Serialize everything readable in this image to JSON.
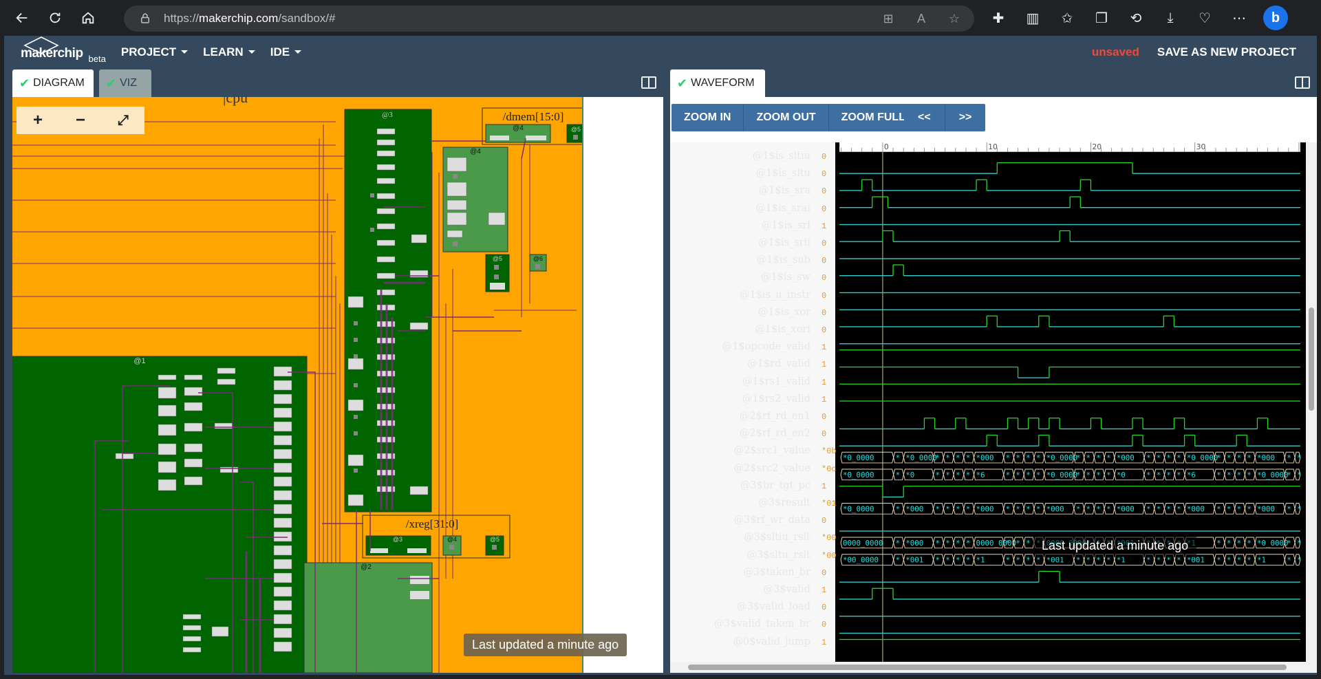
{
  "browser": {
    "url_prefix": "https://",
    "url_host": "makerchip.com",
    "url_path": "/sandbox/#"
  },
  "header": {
    "logo": "makerchip",
    "beta": "beta",
    "menus": [
      "PROJECT",
      "LEARN",
      "IDE"
    ],
    "unsaved": "unsaved",
    "save_new": "SAVE AS NEW PROJECT"
  },
  "left_pane": {
    "tabs": [
      {
        "label": "DIAGRAM",
        "active": true,
        "checked": true
      },
      {
        "label": "VIZ",
        "active": false,
        "checked": true
      }
    ],
    "diagram": {
      "cpu_label": "|cpu",
      "labels": [
        "@3",
        "/dmem[15:0]",
        "@4",
        "@5",
        "@4",
        "@5",
        "@6",
        "@1",
        "/xreg[31:0]",
        "@3",
        "@4",
        "@5",
        "@2"
      ]
    },
    "zoom_in": "+",
    "zoom_out": "−",
    "zoom_fit": "⤢",
    "toast": "Last updated a minute ago"
  },
  "right_pane": {
    "tabs": [
      {
        "label": "WAVEFORM",
        "active": true,
        "checked": true
      }
    ],
    "buttons": [
      "ZOOM IN",
      "ZOOM OUT",
      "ZOOM FULL",
      "<<",
      ">>"
    ],
    "ruler": [
      "0",
      "10",
      "20",
      "30"
    ],
    "toast": "Last updated a minute ago",
    "signals": [
      {
        "name": "@1$is_sltiu",
        "value": "0"
      },
      {
        "name": "@1$is_sltu",
        "value": "0"
      },
      {
        "name": "@1$is_sra",
        "value": "0"
      },
      {
        "name": "@1$is_srai",
        "value": "0"
      },
      {
        "name": "@1$is_srl",
        "value": "1"
      },
      {
        "name": "@1$is_srli",
        "value": "0"
      },
      {
        "name": "@1$is_sub",
        "value": "0"
      },
      {
        "name": "@1$is_sw",
        "value": "0"
      },
      {
        "name": "@1$is_u_instr",
        "value": "0"
      },
      {
        "name": "@1$is_xor",
        "value": "0"
      },
      {
        "name": "@1$is_xori",
        "value": "0"
      },
      {
        "name": "@1$opcode_valid",
        "value": "1"
      },
      {
        "name": "@1$rd_valid",
        "value": "1"
      },
      {
        "name": "@1$rs1_valid",
        "value": "1"
      },
      {
        "name": "@1$rs2_valid",
        "value": "1"
      },
      {
        "name": "@2$rf_rd_en1",
        "value": "0"
      },
      {
        "name": "@2$rf_rd_en2",
        "value": "0"
      },
      {
        "name": "@2$src1_value",
        "value": "*0b"
      },
      {
        "name": "@2$src2_value",
        "value": "*0c"
      },
      {
        "name": "@3$br_tgt_pc",
        "value": "1"
      },
      {
        "name": "@3$result",
        "value": "*01"
      },
      {
        "name": "@3$rf_wr_data",
        "value": "0"
      },
      {
        "name": "@3$sltiu_rslt",
        "value": "*00"
      },
      {
        "name": "@3$sltu_rslt",
        "value": "*00"
      },
      {
        "name": "@3$taken_br",
        "value": "0"
      },
      {
        "name": "@3$valid",
        "value": "1"
      },
      {
        "name": "@3$valid_load",
        "value": "0"
      },
      {
        "name": "@3$valid_taken_br",
        "value": "0"
      },
      {
        "name": "@0$valid_jump",
        "value": "1"
      }
    ],
    "bus_labels": {
      "src1": [
        "*0_0000",
        "*000"
      ],
      "src2": [
        "*0_0000",
        "*6",
        "*0"
      ],
      "result": [
        "*0_0000",
        "*00_0000",
        "*000",
        "*0000",
        "*1"
      ],
      "sltiu": [
        "0000_0000",
        "*1",
        "*000",
        "*001",
        "*0_0001",
        "0000_0000",
        "*0_0000"
      ],
      "sltu": [
        "*00_0000",
        "*0000",
        "*001",
        "*000",
        "*001",
        "*0000",
        "*001",
        "*1",
        "*1",
        "*0"
      ]
    }
  },
  "colors": {
    "diagram_bg": "#ffa500",
    "stage_dark": "#006400",
    "stage_light": "#4a9a4a",
    "wire": "#7b2d7b",
    "wave_high": "#22dd22",
    "wave_low": "#33cccc",
    "bus_text": "#22e0e0"
  }
}
